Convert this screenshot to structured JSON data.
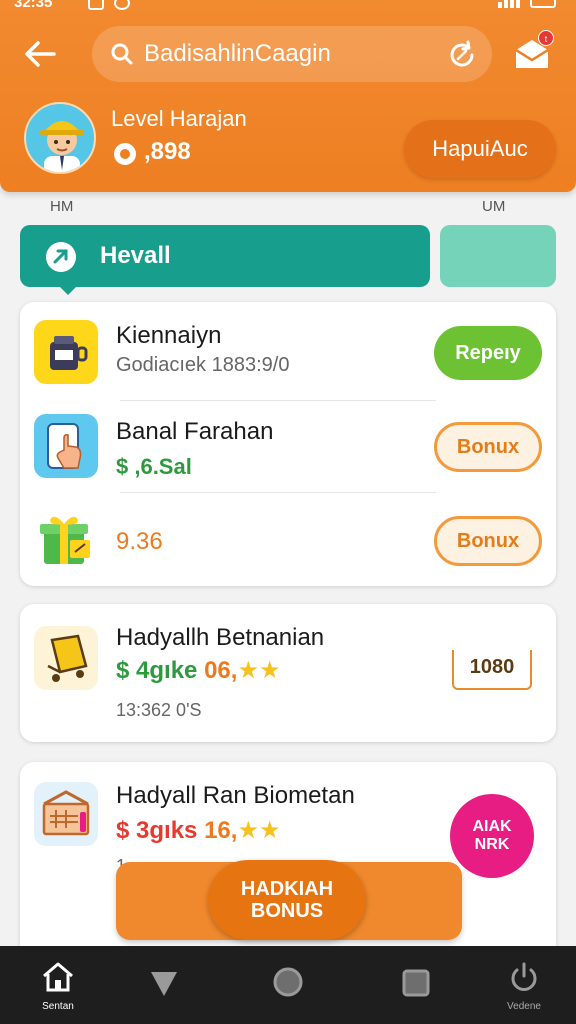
{
  "status_bar": {
    "time": "32:35"
  },
  "header": {
    "search_text": "BadisahlinCaagin",
    "level_label": "Level Harajan",
    "coins": ",898",
    "action_button": "HapuiAuc",
    "mail_badge": "t"
  },
  "section": {
    "left_label": "HM",
    "right_label": "UM"
  },
  "tabs": {
    "active_label": "Hevall"
  },
  "card1": {
    "rows": [
      {
        "title": "Kiennaiyn",
        "subtitle": "Godiacıek 1883:9/0",
        "button": "Repeıy"
      },
      {
        "title": "Banal Farahan",
        "amount": "$ ,6.Sal",
        "button": "Bonux"
      },
      {
        "amount": "9.36",
        "button": "Bonux"
      }
    ]
  },
  "card2": {
    "title": "Hadyallh Betnanian",
    "price": "$ 4gıke",
    "rating": "06,",
    "stars": "★★",
    "subtitle": "13:362 0'S",
    "badge": "1080"
  },
  "card3": {
    "title": "Hadyall Ran Biometan",
    "price": "$ 3gıks",
    "rating": "16,",
    "stars": "★★",
    "subtitle": "1",
    "pink_line1": "AIAK",
    "pink_line2": "NRK"
  },
  "bonus": {
    "line1": "HADKIAH",
    "line2": "BONUS"
  },
  "nav": {
    "home_label": "Sentan",
    "right_label": "Vedene"
  },
  "colors": {
    "brand_orange": "#ee7f22",
    "teal": "#179e8d",
    "green": "#6cc232",
    "pink": "#e81d83"
  }
}
